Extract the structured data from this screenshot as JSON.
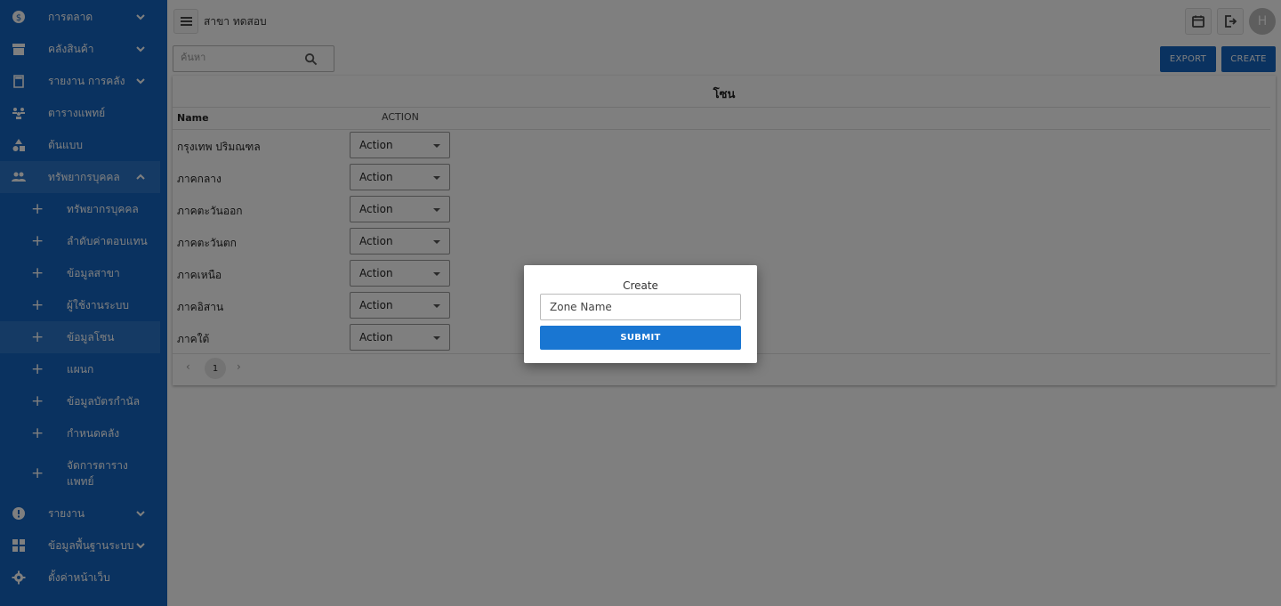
{
  "sidebar": {
    "items": [
      {
        "label": "การตลาด",
        "icon": "dollar-icon"
      },
      {
        "label": "คลังสินค้า",
        "icon": "archive-icon"
      },
      {
        "label": "รายงาน การคลัง",
        "icon": "clipboard-icon"
      },
      {
        "label": "ตารางแพทย์",
        "icon": "people-group-icon"
      },
      {
        "label": "ต้นแบบ",
        "icon": "shapes-icon"
      },
      {
        "label": "ทรัพยากรบุคคล",
        "icon": "people-icon"
      }
    ],
    "subitems": [
      {
        "label": "ทรัพยากรบุคคล"
      },
      {
        "label": "ลำดับค่าตอบแทน"
      },
      {
        "label": "ข้อมูลสาขา"
      },
      {
        "label": "ผู้ใช้งานระบบ"
      },
      {
        "label": "ข้อมูลโซน"
      },
      {
        "label": "แผนก"
      },
      {
        "label": "ข้อมูลบัตรกำนัล"
      },
      {
        "label": "กำหนดคลัง"
      },
      {
        "label": "จัดการตาราง แพทย์"
      }
    ],
    "bottom_items": [
      {
        "label": "รายงาน",
        "icon": "info-icon"
      },
      {
        "label": "ข้อมูลพื้นฐานระบบ",
        "icon": "grid-icon"
      },
      {
        "label": "ตั้งค่าหน้าเว็บ",
        "icon": "gear-icon"
      }
    ],
    "colors": {
      "background": "#1565c0",
      "active": "#2b75c8"
    }
  },
  "header": {
    "branch": "สาขา ทดสอบ",
    "avatar_letter": "H"
  },
  "search": {
    "placeholder": "ค้นหา"
  },
  "toolbar": {
    "export_label": "EXPORT",
    "create_label": "CREATE"
  },
  "table": {
    "title": "โซน",
    "columns": {
      "name": "Name",
      "action": "ACTION"
    },
    "rows": [
      {
        "name": "กรุงเทพ ปริมณฑล",
        "action": "Action"
      },
      {
        "name": "ภาคกลาง",
        "action": "Action"
      },
      {
        "name": "ภาคตะวันออก",
        "action": "Action"
      },
      {
        "name": "ภาคตะวันตก",
        "action": "Action"
      },
      {
        "name": "ภาคเหนือ",
        "action": "Action"
      },
      {
        "name": "ภาคอิสาน",
        "action": "Action"
      },
      {
        "name": "ภาคใต้",
        "action": "Action"
      }
    ],
    "pagination": {
      "prev": "‹",
      "page": "1",
      "next": "›"
    }
  },
  "modal": {
    "title": "Create",
    "input_placeholder": "Zone Name",
    "submit_label": "SUBMIT"
  }
}
